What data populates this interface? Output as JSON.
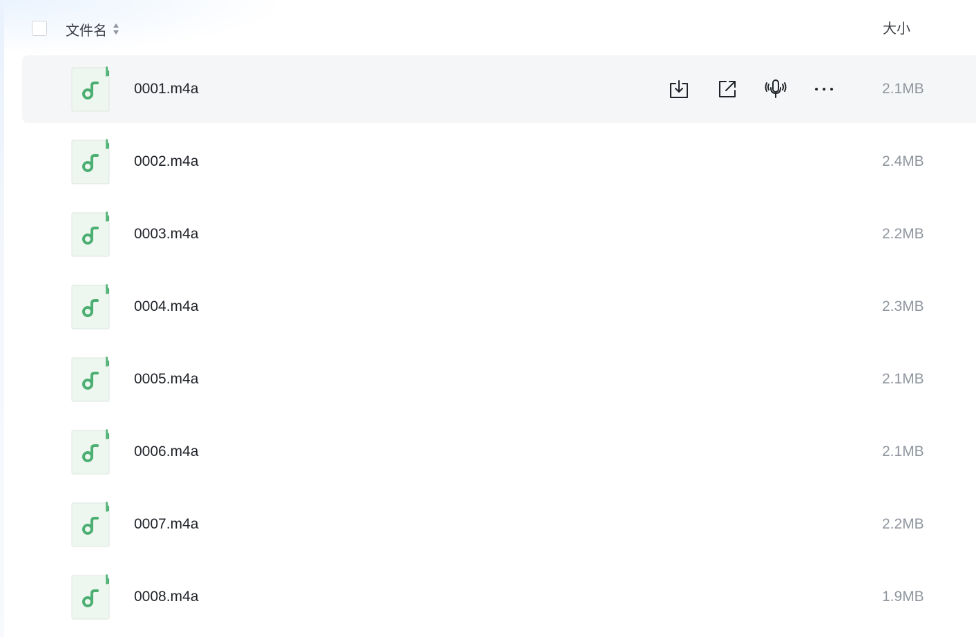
{
  "header": {
    "name_label": "文件名",
    "size_label": "大小"
  },
  "actions": {
    "download": "download-icon",
    "share": "share-icon",
    "transcribe": "transcribe-icon",
    "more": "more-icon"
  },
  "colors": {
    "icon_green": "#4caf72",
    "icon_bg": "#eef6f0",
    "hover_row": "#f5f6f7",
    "size_text": "#8f959e"
  },
  "files": [
    {
      "name": "0001.m4a",
      "size": "2.1MB",
      "icon": "music-file-icon"
    },
    {
      "name": "0002.m4a",
      "size": "2.4MB",
      "icon": "music-file-icon"
    },
    {
      "name": "0003.m4a",
      "size": "2.2MB",
      "icon": "music-file-icon"
    },
    {
      "name": "0004.m4a",
      "size": "2.3MB",
      "icon": "music-file-icon"
    },
    {
      "name": "0005.m4a",
      "size": "2.1MB",
      "icon": "music-file-icon"
    },
    {
      "name": "0006.m4a",
      "size": "2.1MB",
      "icon": "music-file-icon"
    },
    {
      "name": "0007.m4a",
      "size": "2.2MB",
      "icon": "music-file-icon"
    },
    {
      "name": "0008.m4a",
      "size": "1.9MB",
      "icon": "music-file-icon"
    }
  ]
}
